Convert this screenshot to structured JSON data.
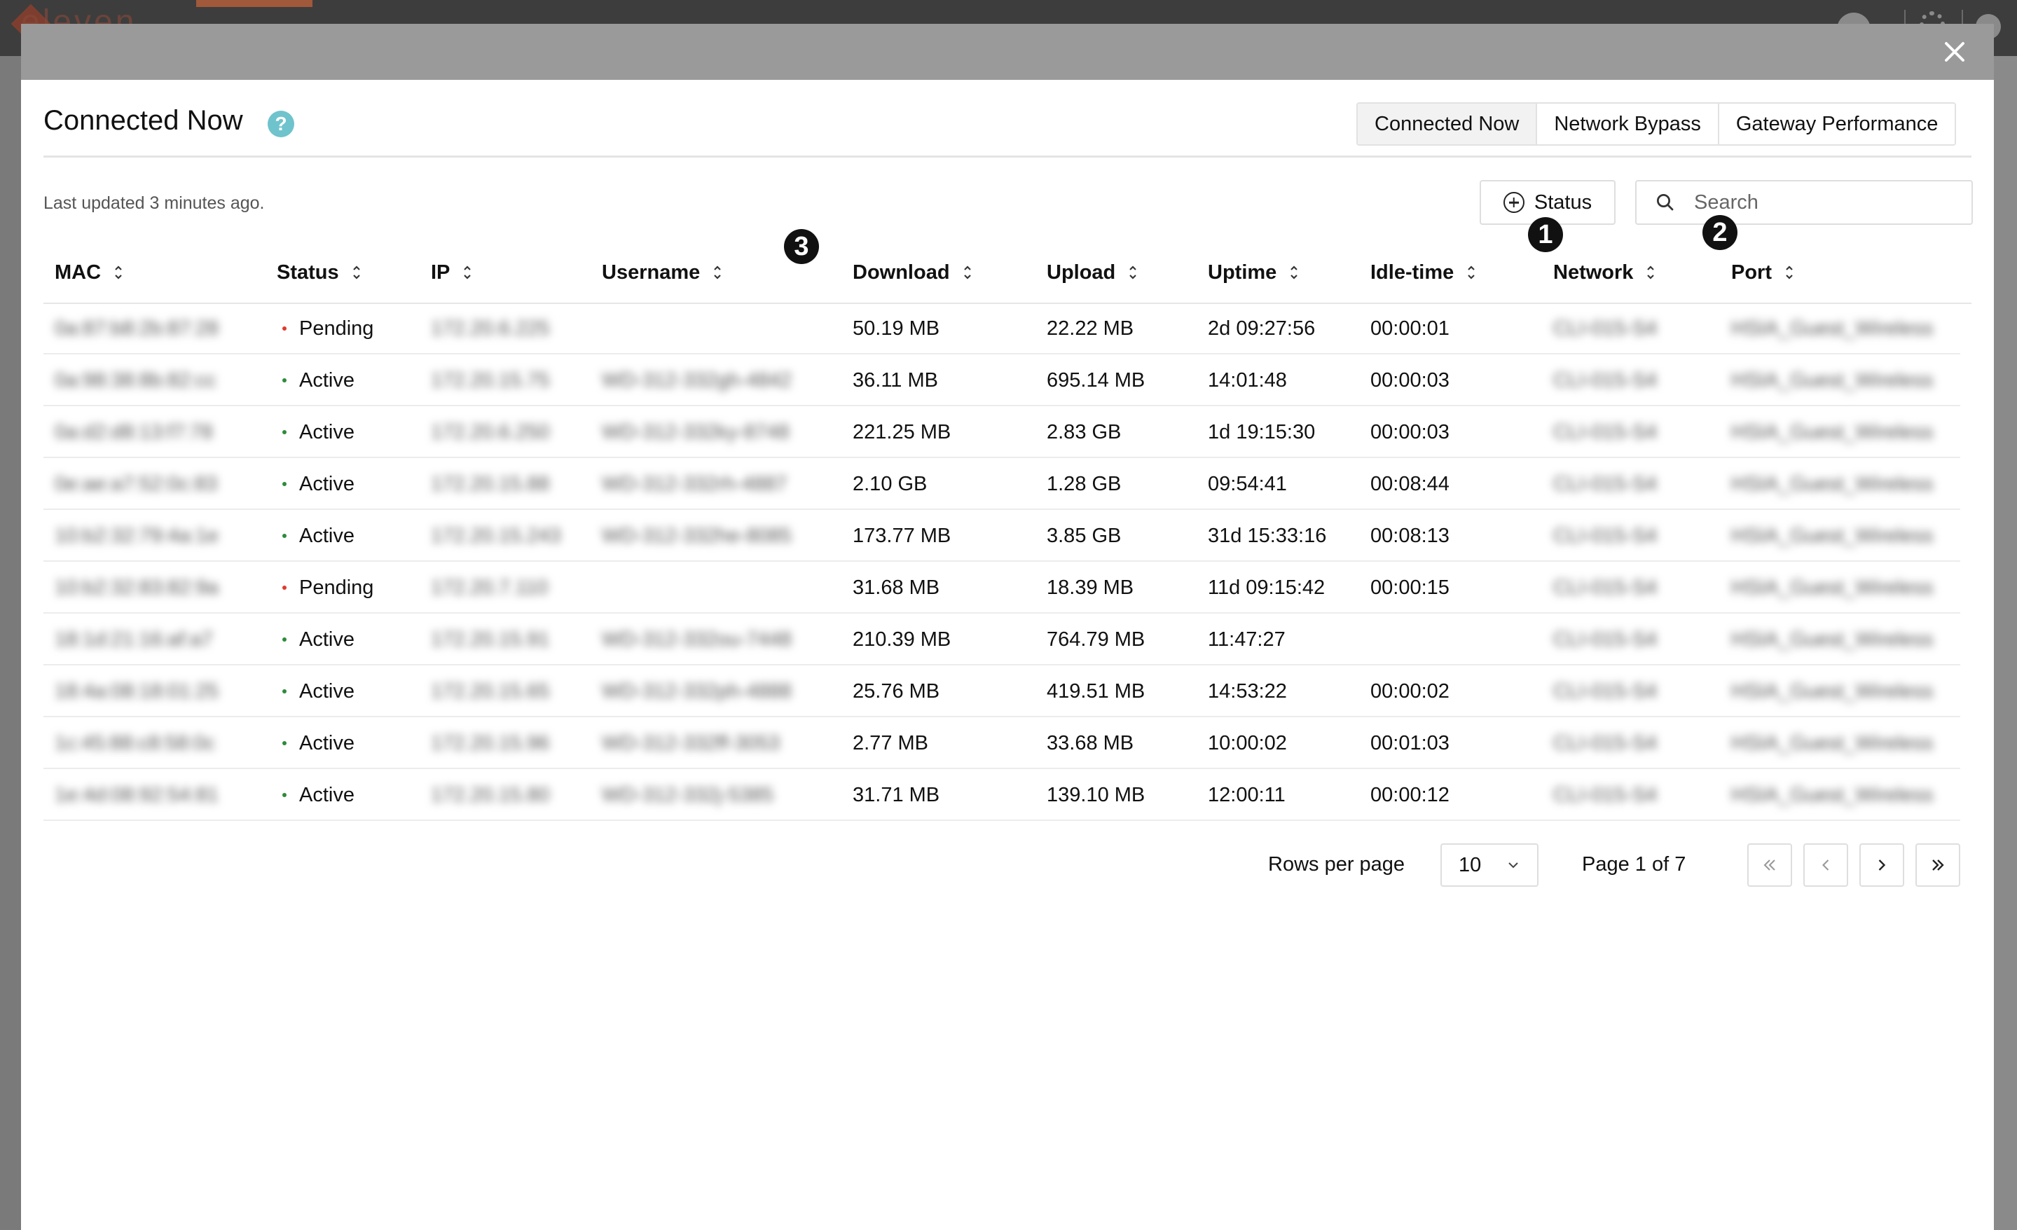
{
  "background": {
    "logo_text": "eleven"
  },
  "modal": {
    "title": "Connected Now",
    "help_glyph": "?",
    "tabs": [
      {
        "label": "Connected Now",
        "active": true
      },
      {
        "label": "Network Bypass",
        "active": false
      },
      {
        "label": "Gateway Performance",
        "active": false
      }
    ],
    "last_updated": "Last updated 3 minutes ago.",
    "status_filter_label": "Status",
    "search_placeholder": "Search",
    "callouts": [
      "1",
      "2",
      "3"
    ]
  },
  "table": {
    "columns": [
      "MAC",
      "Status",
      "IP",
      "Username",
      "Download",
      "Upload",
      "Uptime",
      "Idle-time",
      "Network",
      "Port"
    ],
    "rows": [
      {
        "mac": "0a:87:b8:2b:87:28",
        "status": "Pending",
        "ip": "172.20.6.225",
        "username": "",
        "download": "50.19 MB",
        "upload": "22.22 MB",
        "uptime": "2d 09:27:56",
        "idle": "00:00:01",
        "network": "CLI-015-S4",
        "port": "HSIA_Guest_Wireless"
      },
      {
        "mac": "0a:98:38:8b:82:cc",
        "status": "Active",
        "ip": "172.20.15.75",
        "username": "WD-312-332gh-4842",
        "download": "36.11 MB",
        "upload": "695.14 MB",
        "uptime": "14:01:48",
        "idle": "00:00:03",
        "network": "CLI-015-S4",
        "port": "HSIA_Guest_Wireless"
      },
      {
        "mac": "0a:d2:d8:13:f7:78",
        "status": "Active",
        "ip": "172.20.6.250",
        "username": "WD-312-332ky-8748",
        "download": "221.25 MB",
        "upload": "2.83 GB",
        "uptime": "1d 19:15:30",
        "idle": "00:00:03",
        "network": "CLI-015-S4",
        "port": "HSIA_Guest_Wireless"
      },
      {
        "mac": "0e:ae:a7:52:0c:83",
        "status": "Active",
        "ip": "172.20.15.88",
        "username": "WD-312-332rh-4887",
        "download": "2.10 GB",
        "upload": "1.28 GB",
        "uptime": "09:54:41",
        "idle": "00:08:44",
        "network": "CLI-015-S4",
        "port": "HSIA_Guest_Wireless"
      },
      {
        "mac": "10:b2:32:79:4a:1e",
        "status": "Active",
        "ip": "172.20.15.243",
        "username": "WD-312-332he-8085",
        "download": "173.77 MB",
        "upload": "3.85 GB",
        "uptime": "31d 15:33:16",
        "idle": "00:08:13",
        "network": "CLI-015-S4",
        "port": "HSIA_Guest_Wireless"
      },
      {
        "mac": "10:b2:32:83:82:9a",
        "status": "Pending",
        "ip": "172.20.7.110",
        "username": "",
        "download": "31.68 MB",
        "upload": "18.39 MB",
        "uptime": "11d 09:15:42",
        "idle": "00:00:15",
        "network": "CLI-015-S4",
        "port": "HSIA_Guest_Wireless"
      },
      {
        "mac": "18:1d:21:16:af:a7",
        "status": "Active",
        "ip": "172.20.15.91",
        "username": "WD-312-332ou-7448",
        "download": "210.39 MB",
        "upload": "764.79 MB",
        "uptime": "11:47:27",
        "idle": "",
        "network": "CLI-015-S4",
        "port": "HSIA_Guest_Wireless"
      },
      {
        "mac": "18:4a:08:18:01:25",
        "status": "Active",
        "ip": "172.20.15.65",
        "username": "WD-312-332ph-4888",
        "download": "25.76 MB",
        "upload": "419.51 MB",
        "uptime": "14:53:22",
        "idle": "00:00:02",
        "network": "CLI-015-S4",
        "port": "HSIA_Guest_Wireless"
      },
      {
        "mac": "1c:45:88:c8:58:0c",
        "status": "Active",
        "ip": "172.20.15.96",
        "username": "WD-312-332ff-3053",
        "download": "2.77 MB",
        "upload": "33.68 MB",
        "uptime": "10:00:02",
        "idle": "00:01:03",
        "network": "CLI-015-S4",
        "port": "HSIA_Guest_Wireless"
      },
      {
        "mac": "1e:4d:08:92:54:81",
        "status": "Active",
        "ip": "172.20.15.80",
        "username": "WD-312-332j-5385",
        "download": "31.71 MB",
        "upload": "139.10 MB",
        "uptime": "12:00:11",
        "idle": "00:00:12",
        "network": "CLI-015-S4",
        "port": "HSIA_Guest_Wireless"
      }
    ]
  },
  "pagination": {
    "rows_per_page_label": "Rows per page",
    "rows_per_page_value": "10",
    "page_label": "Page 1 of 7",
    "buttons": [
      "first-page",
      "previous-page",
      "next-page",
      "last-page"
    ]
  },
  "colors": {
    "status_active": "#2e8b3a",
    "status_pending": "#e03a2e",
    "help_icon": "#6fc3cc"
  }
}
